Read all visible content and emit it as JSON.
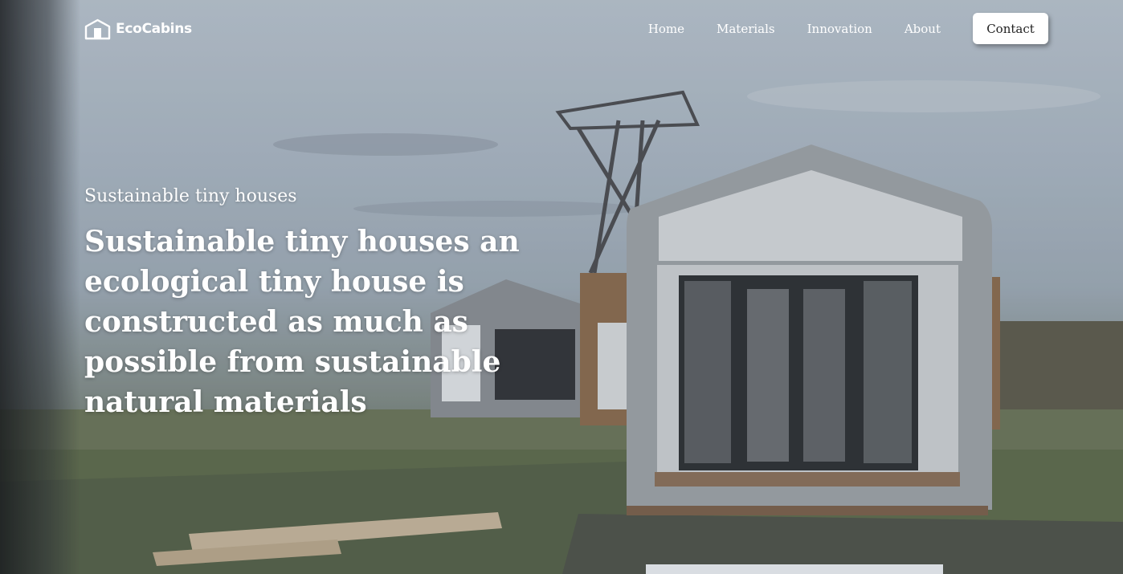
{
  "brand": {
    "name": "EcoCabins"
  },
  "nav": {
    "links": [
      "Home",
      "Materials",
      "Innovation",
      "About"
    ],
    "contact_label": "Contact"
  },
  "hero": {
    "eyebrow": "Sustainable tiny houses",
    "headline": "Sustainable tiny houses an ecological tiny house is constructed as much as possible from sustainable natural materials"
  },
  "colors": {
    "text": "#ffffff",
    "button_bg": "#ffffff",
    "button_text": "#222222"
  }
}
